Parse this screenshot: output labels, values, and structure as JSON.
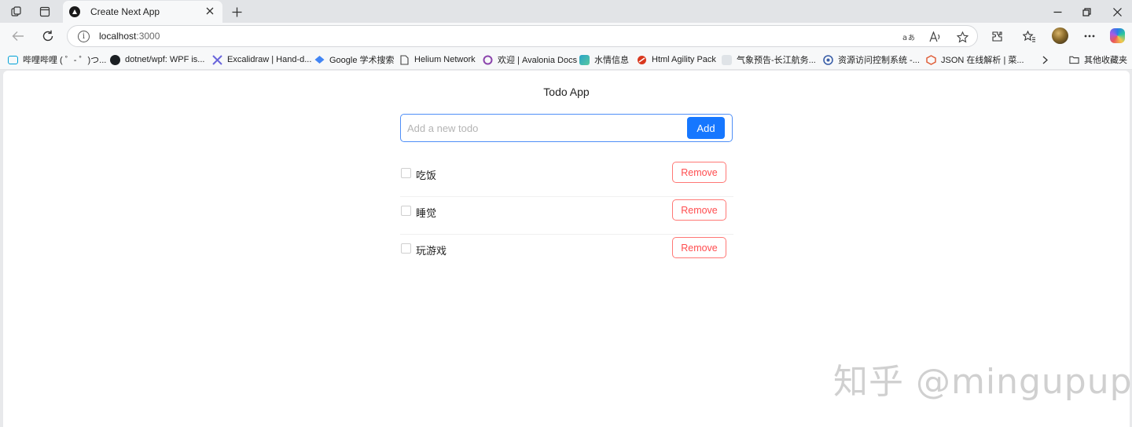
{
  "browser": {
    "tab": {
      "title": "Create Next App"
    },
    "address": {
      "host": "localhost",
      "port": ":3000"
    },
    "bookmarks": [
      {
        "label": "哔哩哔哩 ( ゜- ゜)つ...",
        "icon": "bilibili-icon",
        "color": "#00a1d6"
      },
      {
        "label": "dotnet/wpf: WPF is...",
        "icon": "github-icon",
        "color": "#1b1f23"
      },
      {
        "label": "Excalidraw | Hand-d...",
        "icon": "excalidraw-icon",
        "color": "#6965db"
      },
      {
        "label": "Google 学术搜索",
        "icon": "google-scholar-icon",
        "color": "#4285f4"
      },
      {
        "label": "Helium Network",
        "icon": "page-icon",
        "color": "#555555"
      },
      {
        "label": "欢迎 | Avalonia Docs",
        "icon": "avalonia-icon",
        "color": "#8b44ac"
      },
      {
        "label": "水情信息",
        "icon": "water-icon",
        "color": "#2aa4c8"
      },
      {
        "label": "Html Agility Pack",
        "icon": "htmlagility-icon",
        "color": "#d9381e"
      },
      {
        "label": "气象预告-长江航务...",
        "icon": "weather-icon",
        "color": "#9aa3ad"
      },
      {
        "label": "资源访问控制系统 -...",
        "icon": "access-control-icon",
        "color": "#3b5fa8"
      },
      {
        "label": "JSON 在线解析 | 菜...",
        "icon": "json-icon",
        "color": "#e0613c"
      }
    ],
    "other_favorites": "其他收藏夹"
  },
  "app": {
    "title": "Todo App",
    "input": {
      "placeholder": "Add a new todo",
      "value": ""
    },
    "add_label": "Add",
    "todos": [
      {
        "text": "吃饭",
        "done": false,
        "remove_label": "Remove"
      },
      {
        "text": "睡觉",
        "done": false,
        "remove_label": "Remove"
      },
      {
        "text": "玩游戏",
        "done": false,
        "remove_label": "Remove"
      }
    ]
  },
  "watermark": "知乎 @mingupup",
  "colors": {
    "primary": "#1677ff",
    "danger": "#ff4d4f",
    "input_border": "#4f8ff7"
  }
}
